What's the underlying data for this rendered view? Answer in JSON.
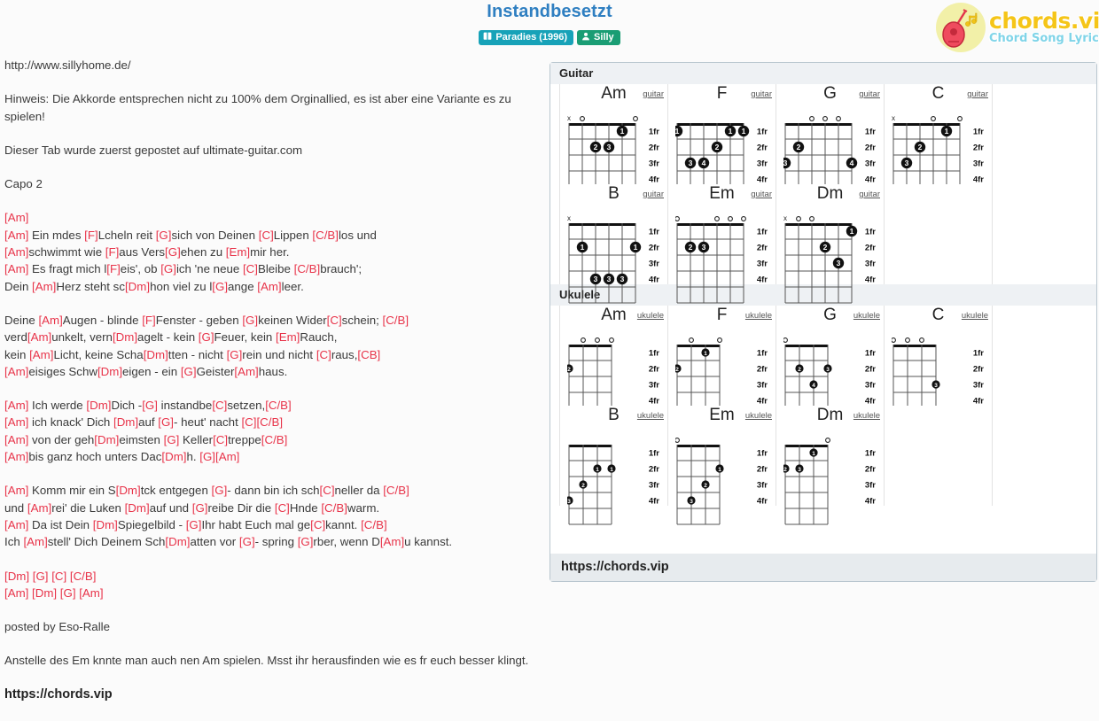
{
  "header": {
    "title": "Instandbesetzt",
    "badges": [
      {
        "icon": "book-icon",
        "label": "Paradies (1996)",
        "color": "#17a2b8"
      },
      {
        "icon": "person-icon",
        "label": "Silly",
        "color": "#1a9d74"
      }
    ],
    "logo": {
      "main": "chords.vip",
      "sub": "Chord Song Lyric",
      "icon": "guitar-icon"
    }
  },
  "lyrics": {
    "blocks": [
      {
        "type": "plain",
        "text": "http://www.sillyhome.de/"
      },
      {
        "type": "plain",
        "text": "Hinweis: Die Akkorde entsprechen nicht zu 100% dem Orginallied, es ist aber eine Variante es zu spielen!"
      },
      {
        "type": "plain",
        "text": "Dieser Tab wurde zuerst gepostet auf ultimate-guitar.com"
      },
      {
        "type": "plain",
        "text": "Capo 2"
      },
      {
        "type": "chordblock",
        "lines": [
          [
            {
              "c": "[Am]"
            }
          ],
          [
            {
              "c": "[Am]"
            },
            {
              "t": " Ein mdes "
            },
            {
              "c": "[F]"
            },
            {
              "t": "Lcheln reit "
            },
            {
              "c": "[G]"
            },
            {
              "t": "sich von Deinen "
            },
            {
              "c": "[C]"
            },
            {
              "t": "Lippen "
            },
            {
              "c": "[C/B]"
            },
            {
              "t": "los und"
            }
          ],
          [
            {
              "c": "[Am]"
            },
            {
              "t": "schwimmt wie "
            },
            {
              "c": "[F]"
            },
            {
              "t": "aus Vers"
            },
            {
              "c": "[G]"
            },
            {
              "t": "ehen zu "
            },
            {
              "c": "[Em]"
            },
            {
              "t": "mir her."
            }
          ],
          [
            {
              "c": "[Am]"
            },
            {
              "t": " Es fragt mich l"
            },
            {
              "c": "[F]"
            },
            {
              "t": "eis', ob "
            },
            {
              "c": "[G]"
            },
            {
              "t": "ich 'ne neue "
            },
            {
              "c": "[C]"
            },
            {
              "t": "Bleibe "
            },
            {
              "c": "[C/B]"
            },
            {
              "t": "brauch';"
            }
          ],
          [
            {
              "t": "Dein "
            },
            {
              "c": "[Am]"
            },
            {
              "t": "Herz steht sc"
            },
            {
              "c": "[Dm]"
            },
            {
              "t": "hon viel zu l"
            },
            {
              "c": "[G]"
            },
            {
              "t": "ange "
            },
            {
              "c": "[Am]"
            },
            {
              "t": "leer."
            }
          ]
        ]
      },
      {
        "type": "chordblock",
        "lines": [
          [
            {
              "t": "Deine "
            },
            {
              "c": "[Am]"
            },
            {
              "t": "Augen - blinde "
            },
            {
              "c": "[F]"
            },
            {
              "t": "Fenster - geben "
            },
            {
              "c": "[G]"
            },
            {
              "t": "keinen Wider"
            },
            {
              "c": "[C]"
            },
            {
              "t": "schein; "
            },
            {
              "c": "[C/B]"
            }
          ],
          [
            {
              "t": "verd"
            },
            {
              "c": "[Am]"
            },
            {
              "t": "unkelt, vern"
            },
            {
              "c": "[Dm]"
            },
            {
              "t": "agelt - kein "
            },
            {
              "c": "[G]"
            },
            {
              "t": "Feuer, kein "
            },
            {
              "c": "[Em]"
            },
            {
              "t": "Rauch,"
            }
          ],
          [
            {
              "t": "kein "
            },
            {
              "c": "[Am]"
            },
            {
              "t": "Licht, keine Scha"
            },
            {
              "c": "[Dm]"
            },
            {
              "t": "tten - nicht "
            },
            {
              "c": "[G]"
            },
            {
              "t": "rein und nicht "
            },
            {
              "c": "[C]"
            },
            {
              "t": "raus,"
            },
            {
              "c": "[CB]"
            }
          ],
          [
            {
              "c": "[Am]"
            },
            {
              "t": "eisiges Schw"
            },
            {
              "c": "[Dm]"
            },
            {
              "t": "eigen - ein "
            },
            {
              "c": "[G]"
            },
            {
              "t": "Geister"
            },
            {
              "c": "[Am]"
            },
            {
              "t": "haus."
            }
          ]
        ]
      },
      {
        "type": "chordblock",
        "lines": [
          [
            {
              "c": "[Am]"
            },
            {
              "t": " Ich werde "
            },
            {
              "c": "[Dm]"
            },
            {
              "t": "Dich -"
            },
            {
              "c": "[G]"
            },
            {
              "t": " instandbe"
            },
            {
              "c": "[C]"
            },
            {
              "t": "setzen,"
            },
            {
              "c": "[C/B]"
            }
          ],
          [
            {
              "c": "[Am]"
            },
            {
              "t": " ich knack' Dich "
            },
            {
              "c": "[Dm]"
            },
            {
              "t": "auf "
            },
            {
              "c": "[G]"
            },
            {
              "t": "- heut' nacht "
            },
            {
              "c": "[C]"
            },
            {
              "c2": "[C/B]"
            }
          ],
          [
            {
              "c": "[Am]"
            },
            {
              "t": " von der geh"
            },
            {
              "c": "[Dm]"
            },
            {
              "t": "eimsten "
            },
            {
              "c": "[G]"
            },
            {
              "t": " Keller"
            },
            {
              "c": "[C]"
            },
            {
              "t": "treppe"
            },
            {
              "c2": "[C/B]"
            }
          ],
          [
            {
              "c": "[Am]"
            },
            {
              "t": "bis ganz hoch unters Dac"
            },
            {
              "c": "[Dm]"
            },
            {
              "t": "h. "
            },
            {
              "c": "[G]"
            },
            {
              "c2": "[Am]"
            }
          ]
        ]
      },
      {
        "type": "chordblock",
        "lines": [
          [
            {
              "c": "[Am]"
            },
            {
              "t": " Komm mir ein S"
            },
            {
              "c": "[Dm]"
            },
            {
              "t": "tck entgegen "
            },
            {
              "c": "[G]"
            },
            {
              "t": "- dann bin ich sch"
            },
            {
              "c": "[C]"
            },
            {
              "t": "neller da "
            },
            {
              "c": "[C/B]"
            }
          ],
          [
            {
              "t": "und "
            },
            {
              "c": "[Am]"
            },
            {
              "t": "rei' die Luken "
            },
            {
              "c": "[Dm]"
            },
            {
              "t": "auf und "
            },
            {
              "c": "[G]"
            },
            {
              "t": "reibe Dir die "
            },
            {
              "c": "[C]"
            },
            {
              "t": "Hnde "
            },
            {
              "c": "[C/B]"
            },
            {
              "t": "warm."
            }
          ],
          [
            {
              "c": "[Am]"
            },
            {
              "t": " Da ist Dein "
            },
            {
              "c": "[Dm]"
            },
            {
              "t": "Spiegelbild - "
            },
            {
              "c": "[G]"
            },
            {
              "t": "Ihr habt Euch mal ge"
            },
            {
              "c": "[C]"
            },
            {
              "t": "kannt. "
            },
            {
              "c": "[C/B]"
            }
          ],
          [
            {
              "t": "Ich "
            },
            {
              "c": "[Am]"
            },
            {
              "t": "stell' Dich Deinem Sch"
            },
            {
              "c": "[Dm]"
            },
            {
              "t": "atten vor "
            },
            {
              "c": "[G]"
            },
            {
              "t": "- spring "
            },
            {
              "c": "[G]"
            },
            {
              "t": "rber, wenn D"
            },
            {
              "c": "[Am]"
            },
            {
              "t": "u kannst."
            }
          ]
        ]
      },
      {
        "type": "chordblock",
        "lines": [
          [
            {
              "c": "[Dm] [G] [C] [C/B]"
            }
          ],
          [
            {
              "c": "[Am] [Dm] [G] [Am]"
            }
          ]
        ]
      },
      {
        "type": "plain",
        "text": "posted by Eso-Ralle"
      },
      {
        "type": "plain",
        "text": "Anstelle des Em knnte man auch nen Am spielen. Msst ihr herausfinden wie es fr euch besser klingt."
      },
      {
        "type": "bold",
        "text": "https://chords.vip"
      }
    ]
  },
  "chord_panel": {
    "sections": [
      {
        "title": "Guitar",
        "instrument_label": "guitar",
        "strings": 6,
        "frets": 4,
        "fret_labels": [
          "1fr",
          "2fr",
          "3fr",
          "4fr"
        ],
        "chords": [
          {
            "name": "Am",
            "markers": [
              "x",
              "o",
              "",
              "",
              "",
              "o"
            ],
            "dots": [
              {
                "string": 5,
                "fret": 1,
                "finger": "1"
              },
              {
                "string": 3,
                "fret": 2,
                "finger": "2"
              },
              {
                "string": 4,
                "fret": 2,
                "finger": "3"
              }
            ]
          },
          {
            "name": "F",
            "markers": [
              "",
              "",
              "",
              "",
              "",
              ""
            ],
            "dots": [
              {
                "string": 1,
                "fret": 1,
                "finger": "1"
              },
              {
                "string": 5,
                "fret": 1,
                "finger": "1"
              },
              {
                "string": 6,
                "fret": 1,
                "finger": "1"
              },
              {
                "string": 4,
                "fret": 2,
                "finger": "2"
              },
              {
                "string": 2,
                "fret": 3,
                "finger": "3"
              },
              {
                "string": 3,
                "fret": 3,
                "finger": "4"
              }
            ]
          },
          {
            "name": "G",
            "markers": [
              "",
              "",
              "o",
              "o",
              "o",
              ""
            ],
            "dots": [
              {
                "string": 2,
                "fret": 2,
                "finger": "2"
              },
              {
                "string": 1,
                "fret": 3,
                "finger": "3"
              },
              {
                "string": 6,
                "fret": 3,
                "finger": "4"
              }
            ]
          },
          {
            "name": "C",
            "markers": [
              "x",
              "",
              "",
              "o",
              "",
              "o"
            ],
            "dots": [
              {
                "string": 5,
                "fret": 1,
                "finger": "1"
              },
              {
                "string": 3,
                "fret": 2,
                "finger": "2"
              },
              {
                "string": 2,
                "fret": 3,
                "finger": "3"
              }
            ]
          },
          {
            "name": "B",
            "markers": [
              "x",
              "",
              "",
              "",
              "",
              ""
            ],
            "dots": [
              {
                "string": 2,
                "fret": 2,
                "finger": "1"
              },
              {
                "string": 6,
                "fret": 2,
                "finger": "1"
              },
              {
                "string": 3,
                "fret": 4,
                "finger": "3"
              },
              {
                "string": 4,
                "fret": 4,
                "finger": "3"
              },
              {
                "string": 5,
                "fret": 4,
                "finger": "3"
              }
            ]
          },
          {
            "name": "Em",
            "markers": [
              "o",
              "",
              "",
              "o",
              "o",
              "o"
            ],
            "dots": [
              {
                "string": 2,
                "fret": 2,
                "finger": "2"
              },
              {
                "string": 3,
                "fret": 2,
                "finger": "3"
              }
            ]
          },
          {
            "name": "Dm",
            "markers": [
              "x",
              "o",
              "o",
              "",
              "",
              ""
            ],
            "dots": [
              {
                "string": 6,
                "fret": 1,
                "finger": "1"
              },
              {
                "string": 4,
                "fret": 2,
                "finger": "2"
              },
              {
                "string": 5,
                "fret": 3,
                "finger": "3"
              }
            ]
          }
        ]
      },
      {
        "title": "Ukulele",
        "instrument_label": "ukulele",
        "strings": 4,
        "frets": 4,
        "fret_labels": [
          "1fr",
          "2fr",
          "3fr",
          "4fr"
        ],
        "chords": [
          {
            "name": "Am",
            "markers": [
              "",
              "o",
              "o",
              "o"
            ],
            "dots": [
              {
                "string": 1,
                "fret": 2,
                "finger": "2"
              }
            ]
          },
          {
            "name": "F",
            "markers": [
              "",
              "o",
              "",
              "o"
            ],
            "dots": [
              {
                "string": 3,
                "fret": 1,
                "finger": "1"
              },
              {
                "string": 1,
                "fret": 2,
                "finger": "2"
              }
            ]
          },
          {
            "name": "G",
            "markers": [
              "o",
              "",
              "",
              ""
            ],
            "dots": [
              {
                "string": 2,
                "fret": 2,
                "finger": "2"
              },
              {
                "string": 4,
                "fret": 2,
                "finger": "3"
              },
              {
                "string": 3,
                "fret": 3,
                "finger": "4"
              }
            ]
          },
          {
            "name": "C",
            "markers": [
              "o",
              "o",
              "o",
              ""
            ],
            "dots": [
              {
                "string": 4,
                "fret": 3,
                "finger": "3"
              }
            ]
          },
          {
            "name": "B",
            "markers": [
              "",
              "",
              "",
              ""
            ],
            "dots": [
              {
                "string": 3,
                "fret": 2,
                "finger": "1"
              },
              {
                "string": 4,
                "fret": 2,
                "finger": "1"
              },
              {
                "string": 2,
                "fret": 3,
                "finger": "2"
              },
              {
                "string": 1,
                "fret": 4,
                "finger": "3"
              }
            ]
          },
          {
            "name": "Em",
            "markers": [
              "o",
              "",
              "",
              ""
            ],
            "dots": [
              {
                "string": 4,
                "fret": 2,
                "finger": "1"
              },
              {
                "string": 3,
                "fret": 3,
                "finger": "2"
              },
              {
                "string": 2,
                "fret": 4,
                "finger": "3"
              }
            ]
          },
          {
            "name": "Dm",
            "markers": [
              "",
              "",
              "",
              "o"
            ],
            "dots": [
              {
                "string": 3,
                "fret": 1,
                "finger": "1"
              },
              {
                "string": 1,
                "fret": 2,
                "finger": "2"
              },
              {
                "string": 2,
                "fret": 2,
                "finger": "3"
              }
            ]
          }
        ]
      }
    ],
    "footer_link": "https://chords.vip"
  }
}
